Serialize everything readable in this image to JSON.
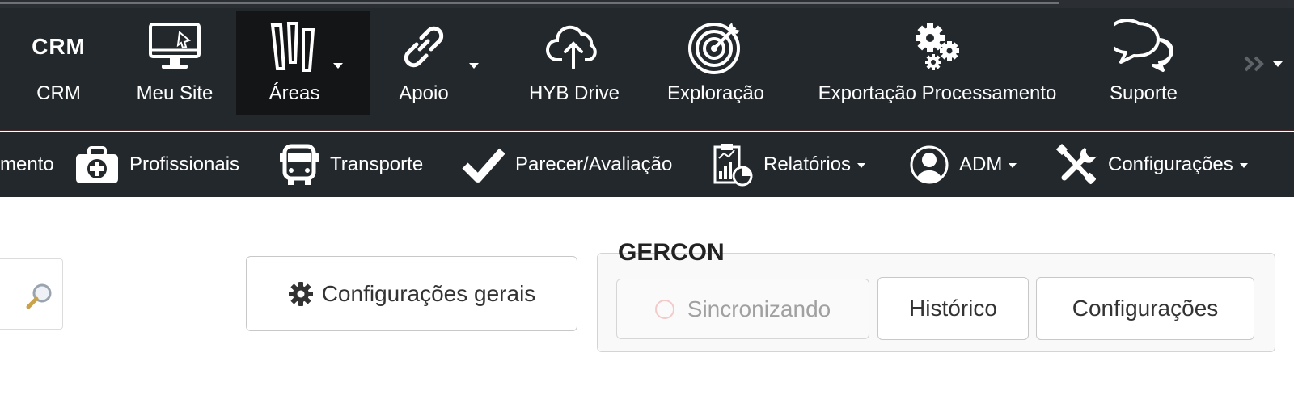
{
  "top_nav": {
    "items": [
      {
        "label": "CRM",
        "icon_text": "CRM",
        "icon": "crm-text-icon"
      },
      {
        "label": "Meu Site",
        "icon": "monitor-icon"
      },
      {
        "label": "Áreas",
        "icon": "columns-icon",
        "active": true,
        "has_dropdown": true
      },
      {
        "label": "Apoio",
        "icon": "link-icon",
        "has_dropdown": true
      },
      {
        "label": "HYB Drive",
        "icon": "cloud-upload-icon"
      },
      {
        "label": "Exploração",
        "icon": "target-icon"
      },
      {
        "label": "Exportação Processamento",
        "icon": "gears-icon"
      },
      {
        "label": "Suporte",
        "icon": "chat-bubbles-icon"
      }
    ],
    "more_icon": "double-chevron-right-icon"
  },
  "sub_nav": {
    "items": [
      {
        "label": "mento",
        "icon": null
      },
      {
        "label": "Profissionais",
        "icon": "medical-kit-icon"
      },
      {
        "label": "Transporte",
        "icon": "bus-icon"
      },
      {
        "label": "Parecer/Avaliação",
        "icon": "checkmark-icon"
      },
      {
        "label": "Relatórios",
        "icon": "report-chart-icon",
        "has_dropdown": true
      },
      {
        "label": "ADM",
        "icon": "user-circle-icon",
        "has_dropdown": true
      },
      {
        "label": "Configurações",
        "icon": "tools-icon",
        "has_dropdown": true
      }
    ]
  },
  "search": {
    "icon": "magnifier-icon"
  },
  "general_settings_button": {
    "label": "Configurações gerais",
    "icon": "gear-icon"
  },
  "gercon": {
    "title": "GERCON",
    "sync_button": {
      "label": "Sincronizando",
      "state": "disabled"
    },
    "history_button": {
      "label": "Histórico"
    },
    "settings_button": {
      "label": "Configurações"
    }
  },
  "colors": {
    "nav_background": "#23282c",
    "nav_active": "#131517",
    "nav_text": "#ffffff",
    "page_background": "#ffffff"
  }
}
